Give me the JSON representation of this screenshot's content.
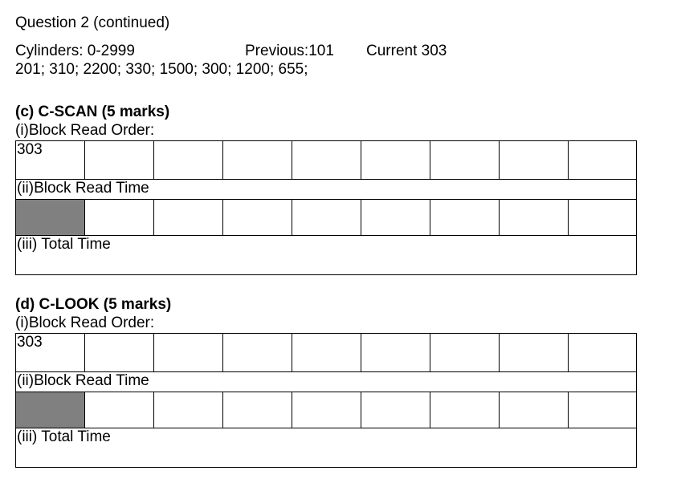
{
  "heading": "Question 2 (continued)",
  "cylinders": "Cylinders: 0-2999",
  "previous": "Previous:101",
  "current": "Current 303",
  "requests": "201; 310; 2200; 330; 1500; 300; 1200; 655;",
  "sections": [
    {
      "title": "(c) C-SCAN  (5 marks)",
      "read_order_label": "(i)Block Read Order:",
      "read_order_cells": [
        "303",
        "",
        "",
        "",
        "",
        "",
        "",
        "",
        ""
      ],
      "read_time_label": "(ii)Block Read Time",
      "total_time_label": "(iii) Total Time"
    },
    {
      "title": "(d) C-LOOK  (5 marks)",
      "read_order_label": "(i)Block Read Order:",
      "read_order_cells": [
        "303",
        "",
        "",
        "",
        "",
        "",
        "",
        "",
        ""
      ],
      "read_time_label": "(ii)Block Read Time",
      "total_time_label": "(iii) Total Time"
    }
  ]
}
